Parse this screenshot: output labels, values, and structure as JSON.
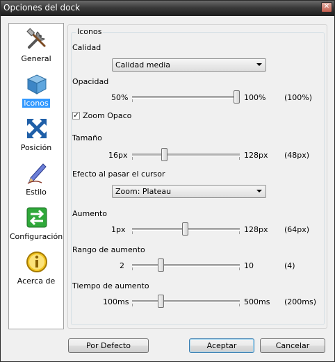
{
  "window": {
    "title": "Opciones del dock",
    "close_glyph": "✕"
  },
  "sidebar": {
    "items": [
      {
        "label": "General",
        "icon": "tools-icon"
      },
      {
        "label": "Iconos",
        "icon": "cube-icon",
        "selected": true
      },
      {
        "label": "Posición",
        "icon": "move-arrows-icon"
      },
      {
        "label": "Estilo",
        "icon": "pen-icon"
      },
      {
        "label": "Configuración",
        "icon": "swap-arrows-icon"
      },
      {
        "label": "Acerca de",
        "icon": "info-icon"
      }
    ]
  },
  "panel": {
    "group_title": "Iconos",
    "calidad": {
      "label": "Calidad",
      "value": "Calidad media"
    },
    "opacidad": {
      "label": "Opacidad",
      "min": "50%",
      "max": "100%",
      "current": "(100%)",
      "fraction": 1.0
    },
    "zoom_opaco": {
      "label": "Zoom Opaco",
      "checked": true,
      "check_glyph": "✓"
    },
    "tamano": {
      "label": "Tamaño",
      "min": "16px",
      "max": "128px",
      "current": "(48px)",
      "fraction": 0.2857
    },
    "efecto": {
      "label": "Efecto al pasar el cursor",
      "value": "Zoom: Plateau"
    },
    "aumento": {
      "label": "Aumento",
      "min": "1px",
      "max": "128px",
      "current": "(64px)",
      "fraction": 0.496
    },
    "rango": {
      "label": "Rango de aumento",
      "min": "2",
      "max": "10",
      "current": "(4)",
      "fraction": 0.25
    },
    "tiempo": {
      "label": "Tiempo de aumento",
      "min": "100ms",
      "max": "500ms",
      "current": "(200ms)",
      "fraction": 0.25
    }
  },
  "buttons": {
    "default_label": "Por Defecto",
    "accept_label": "Aceptar",
    "cancel_label": "Cancelar"
  }
}
